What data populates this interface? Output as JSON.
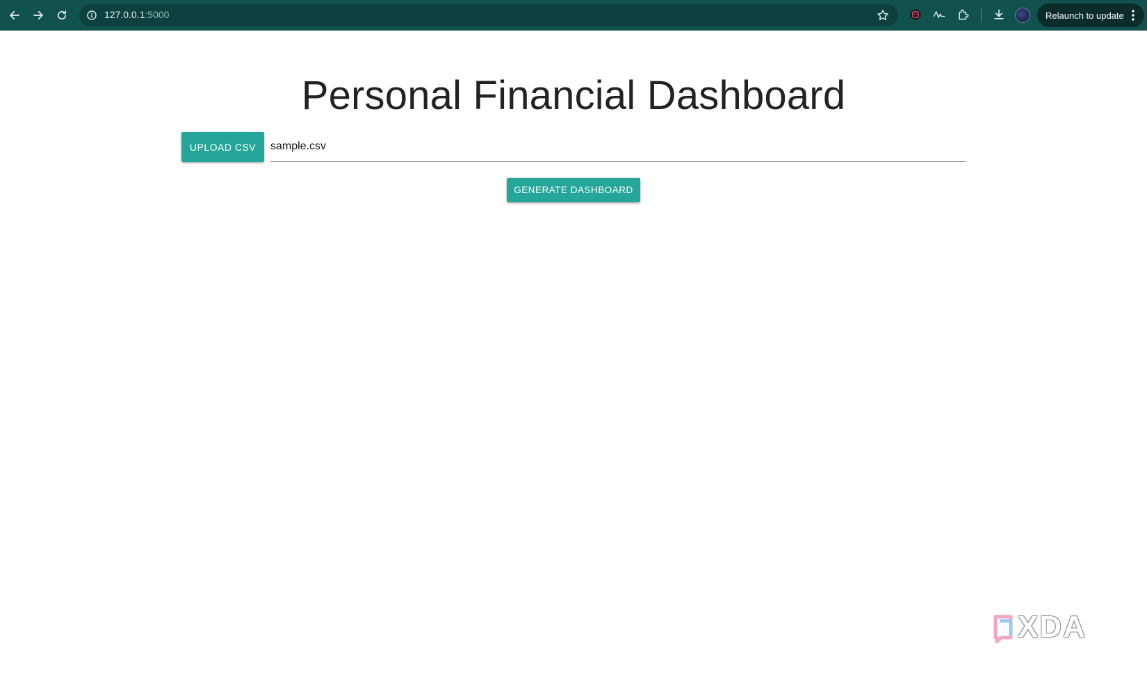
{
  "browser": {
    "url_host": "127.0.0.1",
    "url_port": ":5000",
    "relaunch_label": "Relaunch to update"
  },
  "page": {
    "title": "Personal Financial Dashboard",
    "upload_label": "UPLOAD CSV",
    "file_path_value": "sample.csv",
    "generate_label": "GENERATE DASHBOARD"
  },
  "watermark": {
    "text": "XDA"
  },
  "colors": {
    "toolbar": "#11524f",
    "accent": "#26a69a"
  }
}
